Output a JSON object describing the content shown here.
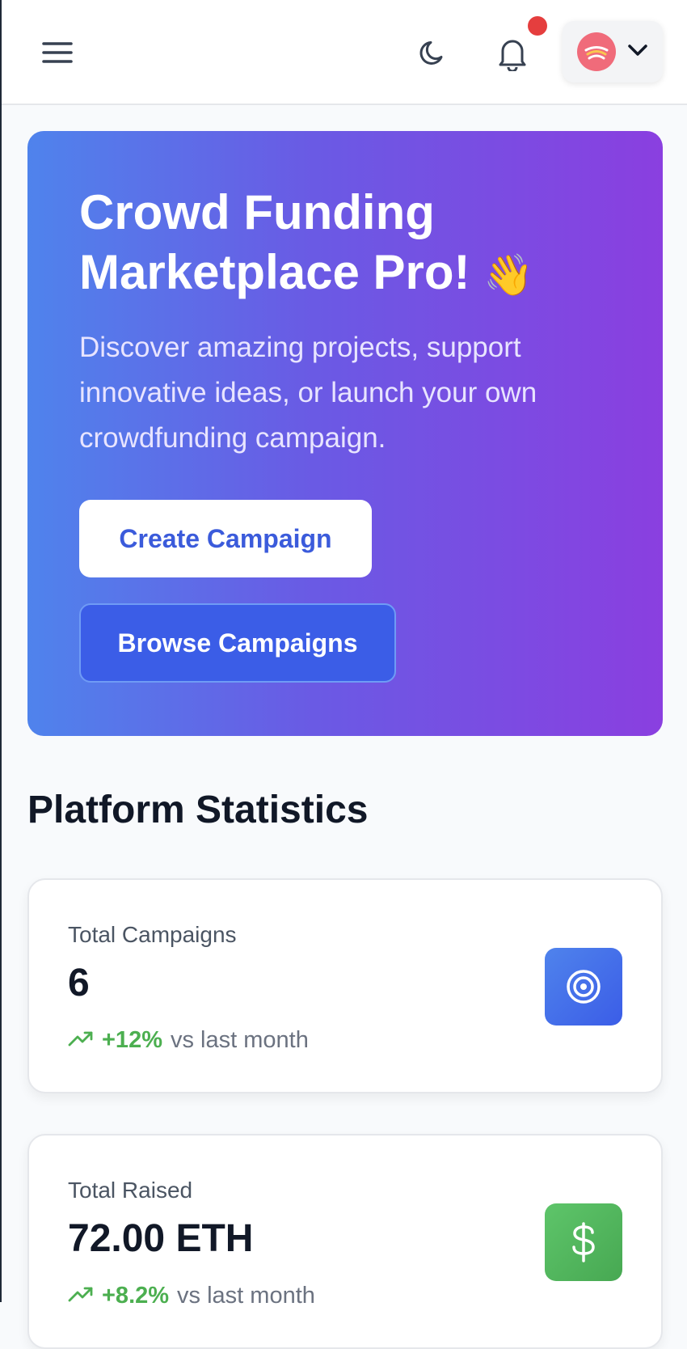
{
  "header": {
    "menu_icon": "hamburger-menu-icon",
    "theme_icon": "moon-icon",
    "notification_icon": "bell-icon",
    "avatar_icon": "sushi-avatar",
    "dropdown_icon": "chevron-down-icon"
  },
  "hero": {
    "title": "Crowd Funding Marketplace Pro!",
    "title_emoji": "👋",
    "subtitle": "Discover amazing projects, support innovative ideas, or launch your own crowdfunding campaign.",
    "create_button": "Create Campaign",
    "browse_button": "Browse Campaigns"
  },
  "stats": {
    "title": "Platform Statistics",
    "cards": [
      {
        "label": "Total Campaigns",
        "value": "6",
        "change": "+12%",
        "suffix": "vs last month",
        "icon": "target-icon"
      },
      {
        "label": "Total Raised",
        "value": "72.00 ETH",
        "change": "+8.2%",
        "suffix": "vs last month",
        "icon": "dollar-icon"
      }
    ]
  },
  "colors": {
    "hero_gradient_start": "#4f83ec",
    "hero_gradient_end": "#8a3fe0",
    "accent_blue": "#3b5de7",
    "positive_green": "#4caf50",
    "notification_dot": "#e53e3e"
  }
}
